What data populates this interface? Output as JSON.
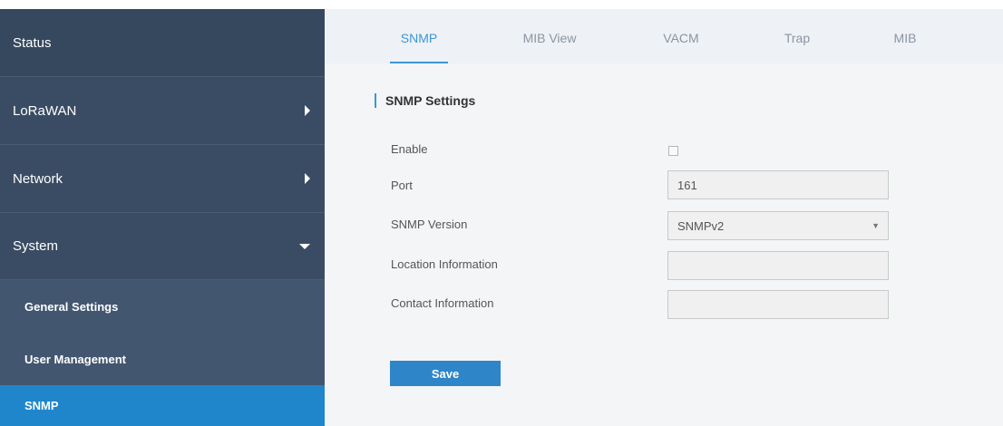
{
  "sidebar": {
    "items": [
      {
        "label": "Status"
      },
      {
        "label": "LoRaWAN"
      },
      {
        "label": "Network"
      },
      {
        "label": "System"
      }
    ],
    "subitems": [
      {
        "label": "General Settings"
      },
      {
        "label": "User Management"
      },
      {
        "label": "SNMP"
      }
    ]
  },
  "tabs": [
    {
      "label": "SNMP",
      "active": true
    },
    {
      "label": "MIB View"
    },
    {
      "label": "VACM"
    },
    {
      "label": "Trap"
    },
    {
      "label": "MIB"
    }
  ],
  "section": {
    "title": "SNMP Settings"
  },
  "form": {
    "enable_label": "Enable",
    "enable_checked": false,
    "port_label": "Port",
    "port_value": "161",
    "version_label": "SNMP Version",
    "version_value": "SNMPv2",
    "location_label": "Location Information",
    "location_value": "",
    "contact_label": "Contact Information",
    "contact_value": ""
  },
  "save_label": "Save",
  "colors": {
    "sidebar_bg": "#3a4c63",
    "active_item": "#1f86cc",
    "accent": "#3d97d3"
  }
}
